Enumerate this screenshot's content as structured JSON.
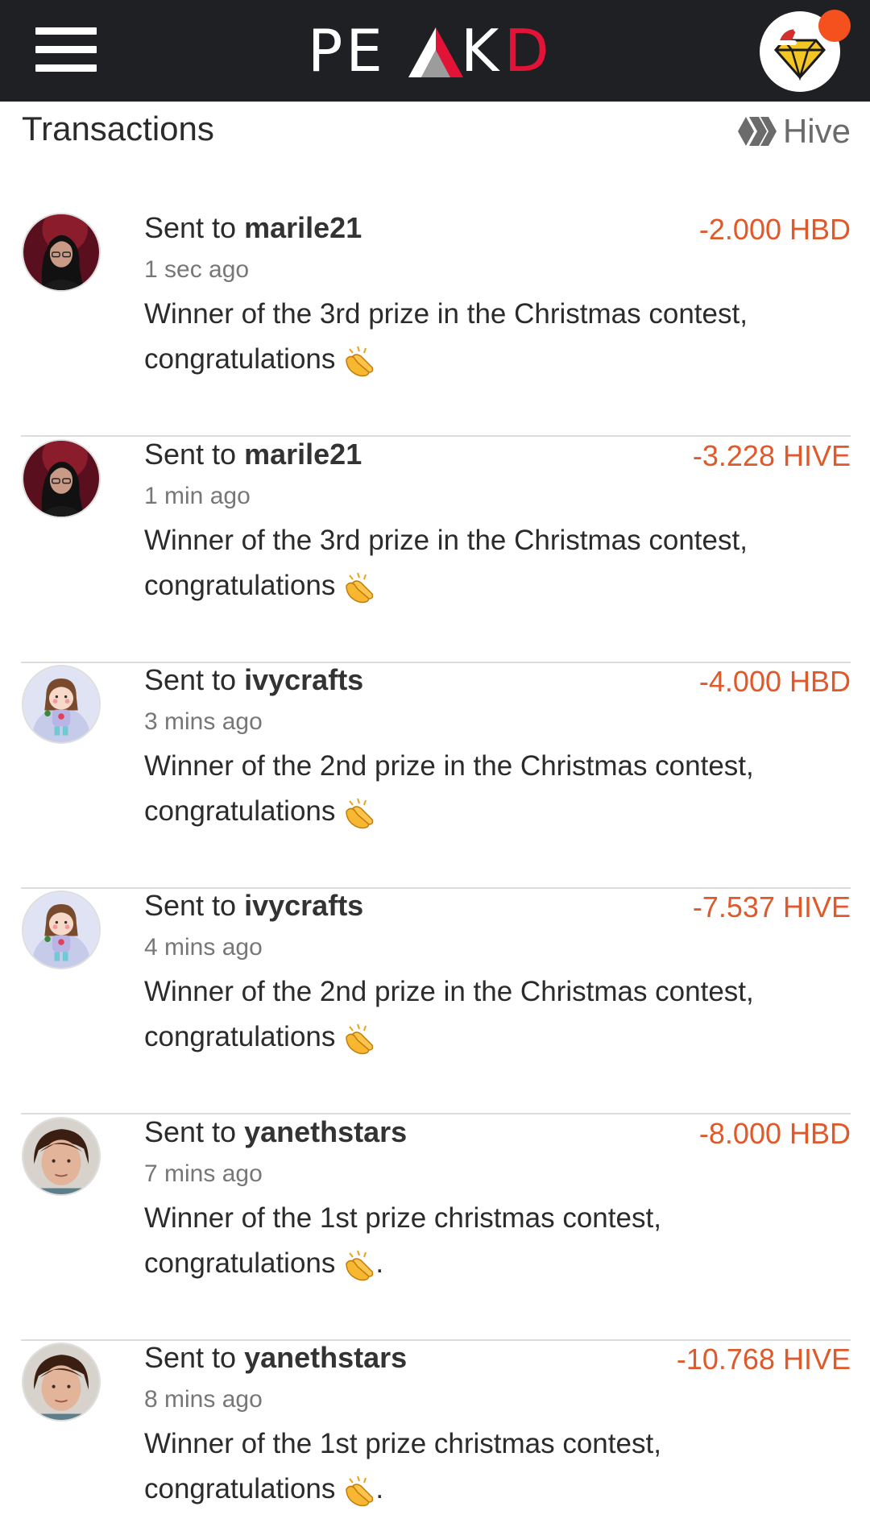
{
  "app": {
    "logo_text": "PEAKD",
    "brand_red": "#e31337",
    "topbar_bg": "#1f2023",
    "notification_color": "#f4511e"
  },
  "header": {
    "title": "Transactions",
    "currency_filter": "Hive"
  },
  "transactions": [
    {
      "prefix": "Sent to",
      "user": "marile21",
      "amount": "-2.000 HBD",
      "time": "1 sec ago",
      "memo_line1": "Winner of the 3rd prize in the Christmas contest,",
      "memo_line2": "congratulations",
      "memo_suffix": "",
      "avatar": "dark-hair-woman-avatar"
    },
    {
      "prefix": "Sent to",
      "user": "marile21",
      "amount": "-3.228 HIVE",
      "time": "1 min ago",
      "memo_line1": "Winner of the 3rd prize in the Christmas contest,",
      "memo_line2": "congratulations",
      "memo_suffix": "",
      "avatar": "dark-hair-woman-avatar"
    },
    {
      "prefix": "Sent to",
      "user": "ivycrafts",
      "amount": "-4.000 HBD",
      "time": "3 mins ago",
      "memo_line1": "Winner of the 2nd prize in the Christmas contest,",
      "memo_line2": "congratulations",
      "memo_suffix": "",
      "avatar": "cartoon-girl-avatar"
    },
    {
      "prefix": "Sent to",
      "user": "ivycrafts",
      "amount": "-7.537 HIVE",
      "time": "4 mins ago",
      "memo_line1": "Winner of the 2nd prize in the Christmas contest,",
      "memo_line2": "congratulations",
      "memo_suffix": "",
      "avatar": "cartoon-girl-avatar"
    },
    {
      "prefix": "Sent to",
      "user": "yanethstars",
      "amount": "-8.000 HBD",
      "time": "7 mins ago",
      "memo_line1": "Winner of the 1st prize christmas contest,",
      "memo_line2": "congratulations",
      "memo_suffix": ".",
      "avatar": "woman-portrait-avatar"
    },
    {
      "prefix": "Sent to",
      "user": "yanethstars",
      "amount": "-10.768 HIVE",
      "time": "8 mins ago",
      "memo_line1": "Winner of the 1st prize christmas contest,",
      "memo_line2": "congratulations",
      "memo_suffix": ".",
      "avatar": "woman-portrait-avatar"
    }
  ]
}
